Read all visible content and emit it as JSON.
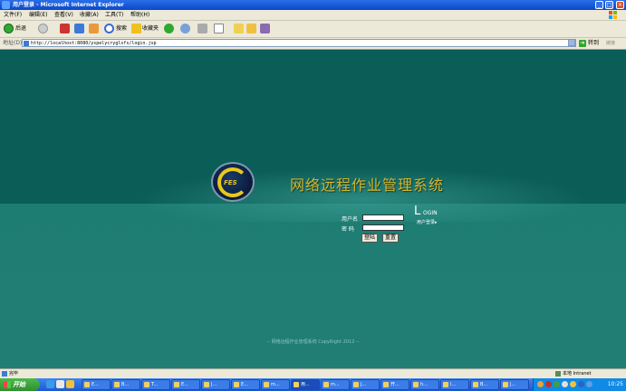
{
  "window": {
    "title": "用户登录 - Microsoft Internet Explorer"
  },
  "menu": [
    "文件(F)",
    "编辑(E)",
    "查看(V)",
    "收藏(A)",
    "工具(T)",
    "帮助(H)"
  ],
  "toolbar": {
    "back_label": "后退",
    "search_label": "搜索",
    "favorites_label": "收藏夹"
  },
  "address": {
    "label": "地址(D)",
    "url": "http://localhost:8080/yspelycryglxfs/login.jsp",
    "go_label": "转到",
    "links_label": "链接"
  },
  "page": {
    "logo_text": "FES",
    "system_title": "网络远程作业管理系统",
    "username_label": "用户名",
    "password_label": "密  码",
    "login_button": "登陆",
    "reset_button": "重置",
    "login_heading_big": "L",
    "login_heading_small": "OGIN",
    "login_cn": "用户登录▸",
    "copyright": "-- 网络远程作业管理系统 CopyRight 2012 --"
  },
  "status": {
    "left_text": "完毕",
    "zone_text": "本地 Intranet"
  },
  "taskbar": {
    "start_label": "开始",
    "tasks": [
      "E...",
      "B...",
      "T...",
      "E...",
      "J...",
      "E...",
      "m...",
      "用...",
      "m...",
      "J...",
      "开...",
      "h...",
      "I...",
      "B...",
      "J..."
    ],
    "clock": "10:25"
  }
}
